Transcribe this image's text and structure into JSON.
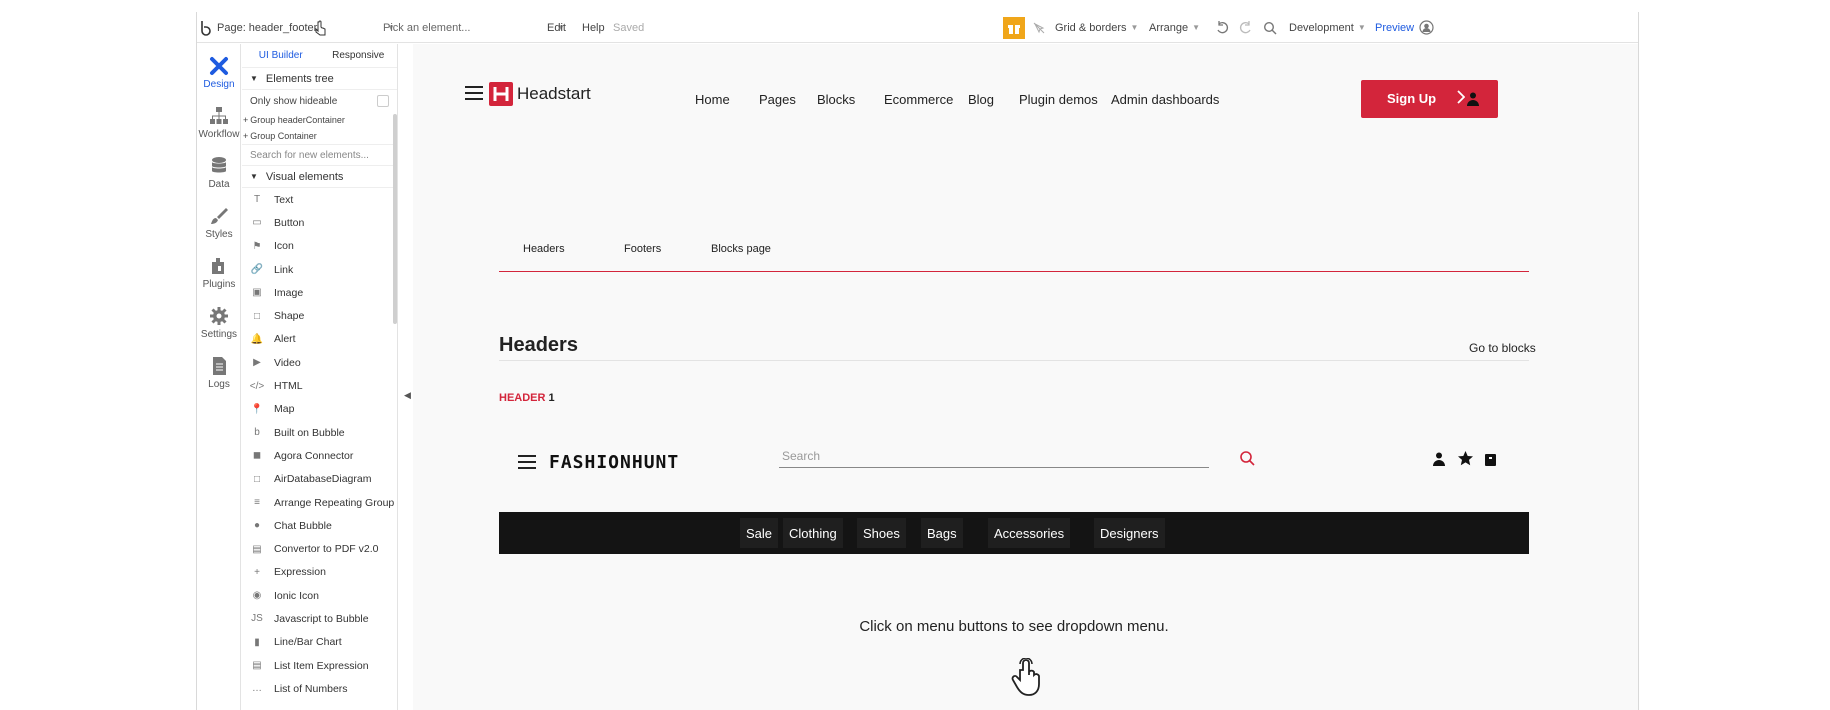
{
  "topbar": {
    "page_label": "Page: header_footer",
    "pick_element": "Pick an element...",
    "edit": "Edit",
    "help": "Help",
    "saved": "Saved",
    "grid": "Grid & borders",
    "arrange": "Arrange",
    "development": "Development",
    "preview": "Preview"
  },
  "rail": {
    "items": [
      {
        "label": "Design"
      },
      {
        "label": "Workflow"
      },
      {
        "label": "Data"
      },
      {
        "label": "Styles"
      },
      {
        "label": "Plugins"
      },
      {
        "label": "Settings"
      },
      {
        "label": "Logs"
      }
    ]
  },
  "panel": {
    "tab_ui": "UI Builder",
    "tab_responsive": "Responsive",
    "elements_tree": "Elements tree",
    "only_show_hideable": "Only show hideable",
    "group_header": "Group headerContainer",
    "group_container": "Group Container",
    "search_placeholder": "Search for new elements...",
    "visual_elements": "Visual elements",
    "items": [
      "Text",
      "Button",
      "Icon",
      "Link",
      "Image",
      "Shape",
      "Alert",
      "Video",
      "HTML",
      "Map",
      "Built on Bubble",
      "Agora Connector",
      "AirDatabaseDiagram",
      "Arrange Repeating Group",
      "Chat Bubble",
      "Convertor to PDF v2.0",
      "Expression",
      "Ionic Icon",
      "Javascript to Bubble",
      "Line/Bar Chart",
      "List Item Expression",
      "List of Numbers"
    ],
    "item_glyphs": [
      "T",
      "▭",
      "⚑",
      "🔗",
      "▣",
      "□",
      "🔔",
      "▶",
      "</>",
      "📍",
      "b",
      "◼",
      "□",
      "≡",
      "●",
      "▤",
      "+",
      "◉",
      "JS",
      "▮",
      "▤",
      "…"
    ]
  },
  "canvas": {
    "brand": "Headstart",
    "nav": [
      "Home",
      "Pages",
      "Blocks",
      "Ecommerce",
      "Blog",
      "Plugin demos",
      "Admin dashboards"
    ],
    "signup": "Sign Up",
    "subtabs": [
      "Headers",
      "Footers",
      "Blocks page"
    ],
    "section_title": "Headers",
    "go_to_blocks": "Go to blocks",
    "header_label": "HEADER",
    "header_num": "1",
    "fashion_logo": "FASHIONHUNT",
    "search_placeholder": "Search",
    "categories": [
      "Sale",
      "Clothing",
      "Shoes",
      "Bags",
      "Accessories",
      "Designers"
    ],
    "hint": "Click on menu buttons to see dropdown menu."
  },
  "colors": {
    "accent_red": "#d3253b",
    "blue": "#1e5be0",
    "dark_bar": "#141414"
  }
}
